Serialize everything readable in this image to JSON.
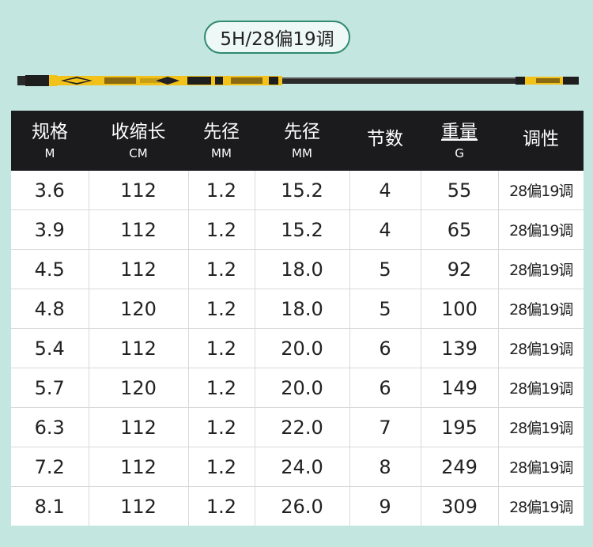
{
  "title": "5H/28偏19调",
  "colors": {
    "background": "#c4e6e0",
    "header_bg": "#1b1b1e",
    "rod_yellow": "#f2c21a",
    "pill_border": "#2f8a70"
  },
  "headers": [
    {
      "main": "规格",
      "unit": "M"
    },
    {
      "main": "收缩长",
      "unit": "CM"
    },
    {
      "main": "先径",
      "unit": "MM"
    },
    {
      "main": "先径",
      "unit": "MM"
    },
    {
      "main": "节数",
      "unit": ""
    },
    {
      "main": "重量",
      "unit": "G"
    },
    {
      "main": "调性",
      "unit": ""
    }
  ],
  "rows": [
    [
      "3.6",
      "112",
      "1.2",
      "15.2",
      "4",
      "55",
      "28偏19调"
    ],
    [
      "3.9",
      "112",
      "1.2",
      "15.2",
      "4",
      "65",
      "28偏19调"
    ],
    [
      "4.5",
      "112",
      "1.2",
      "18.0",
      "5",
      "92",
      "28偏19调"
    ],
    [
      "4.8",
      "120",
      "1.2",
      "18.0",
      "5",
      "100",
      "28偏19调"
    ],
    [
      "5.4",
      "112",
      "1.2",
      "20.0",
      "6",
      "139",
      "28偏19调"
    ],
    [
      "5.7",
      "120",
      "1.2",
      "20.0",
      "6",
      "149",
      "28偏19调"
    ],
    [
      "6.3",
      "112",
      "1.2",
      "22.0",
      "7",
      "195",
      "28偏19调"
    ],
    [
      "7.2",
      "112",
      "1.2",
      "24.0",
      "8",
      "249",
      "28偏19调"
    ],
    [
      "8.1",
      "112",
      "1.2",
      "26.0",
      "9",
      "309",
      "28偏19调"
    ]
  ]
}
